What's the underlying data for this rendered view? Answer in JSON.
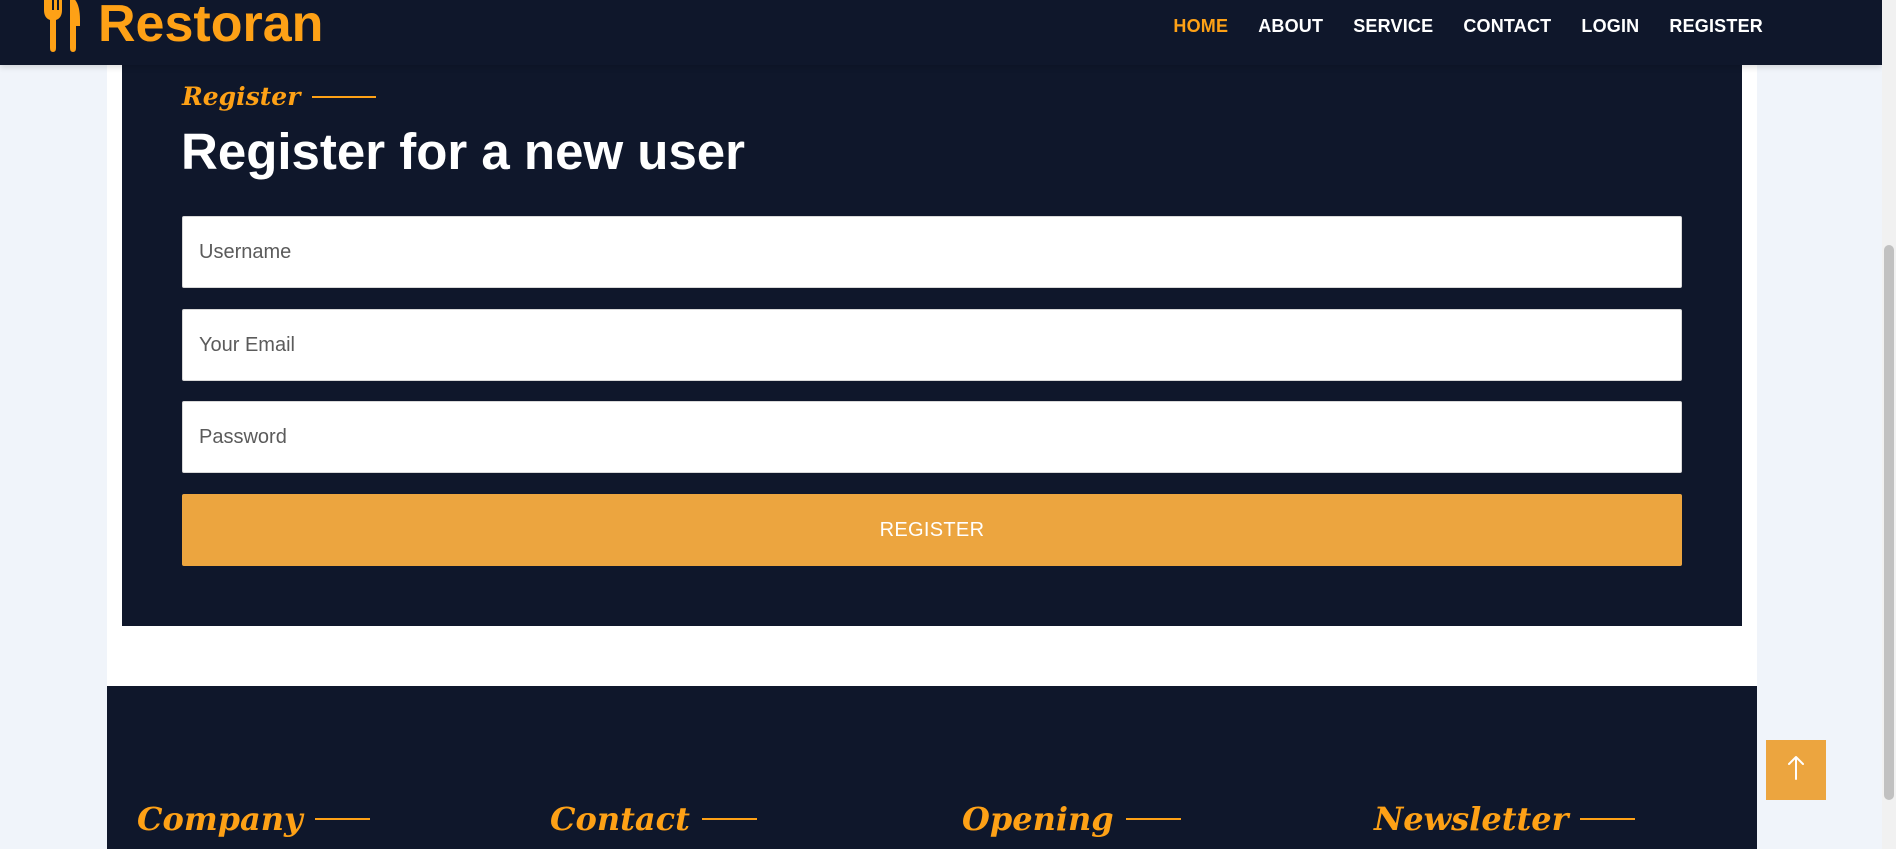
{
  "brand": {
    "name": "Restoran",
    "icon": "fork-knife-icon"
  },
  "nav": {
    "items": [
      {
        "label": "HOME",
        "active": true
      },
      {
        "label": "ABOUT",
        "active": false
      },
      {
        "label": "SERVICE",
        "active": false
      },
      {
        "label": "CONTACT",
        "active": false
      },
      {
        "label": "LOGIN",
        "active": false
      },
      {
        "label": "REGISTER",
        "active": false
      }
    ]
  },
  "register": {
    "tag": "Register",
    "heading": "Register for a new user",
    "username_placeholder": "Username",
    "email_placeholder": "Your Email",
    "password_placeholder": "Password",
    "button_label": "REGISTER"
  },
  "footer": {
    "titles": [
      "Company",
      "Contact",
      "Opening",
      "Newsletter"
    ]
  },
  "back_to_top": {
    "icon": "arrow-up-icon"
  },
  "colors": {
    "primary": "#fea116",
    "button": "#eca53f",
    "dark": "#0f172b",
    "page_bg": "#f0f4fa"
  }
}
